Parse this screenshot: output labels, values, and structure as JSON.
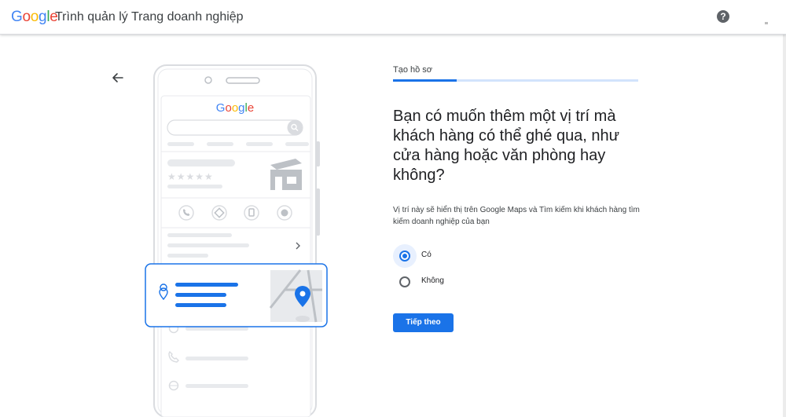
{
  "header": {
    "logo_letters": [
      {
        "ch": "G",
        "color": "#4285F4"
      },
      {
        "ch": "o",
        "color": "#EA4335"
      },
      {
        "ch": "o",
        "color": "#FBBC05"
      },
      {
        "ch": "g",
        "color": "#4285F4"
      },
      {
        "ch": "l",
        "color": "#34A853"
      },
      {
        "ch": "e",
        "color": "#EA4335"
      }
    ],
    "title": "Trình quản lý Trang doanh nghiệp",
    "help_icon": "help-icon",
    "help_glyph": "?"
  },
  "illustration": {
    "phone_logo": "Google",
    "stars": "★★★★★"
  },
  "step": {
    "label": "Tạo hồ sơ",
    "progress": 0.26
  },
  "main": {
    "question": "Bạn có muốn thêm một vị trí mà khách hàng có thể ghé qua, như cửa hàng hoặc văn phòng hay không?",
    "description": "Vị trí này sẽ hiển thị trên Google Maps và Tìm kiếm khi khách hàng tìm kiếm doanh nghiệp của bạn",
    "options": [
      {
        "label": "Có",
        "selected": true
      },
      {
        "label": "Không",
        "selected": false
      }
    ],
    "next_button": "Tiếp theo"
  },
  "colors": {
    "accent": "#1a73e8",
    "accent_light": "#d2e3fc"
  }
}
